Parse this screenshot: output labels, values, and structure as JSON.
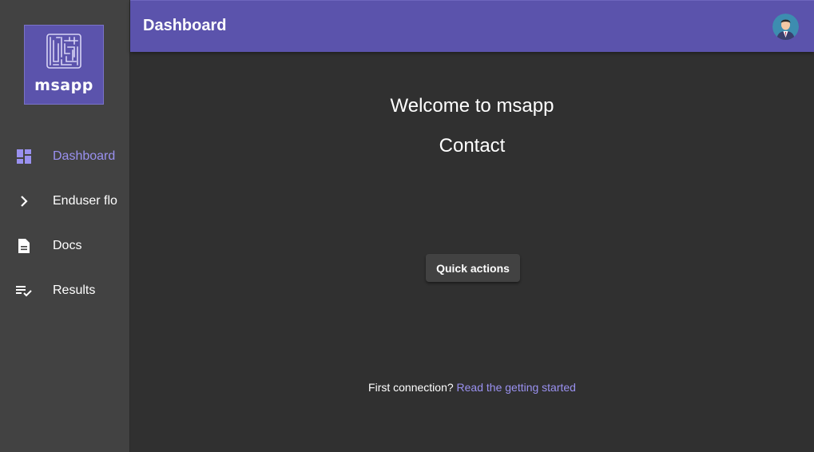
{
  "app": {
    "logo_text": "msapp"
  },
  "colors": {
    "brand": "#5b53ac",
    "accent": "#9a91f0",
    "background": "#303030",
    "sidebar": "#424242"
  },
  "sidebar": {
    "items": [
      {
        "label": "Dashboard",
        "icon": "dashboard-icon",
        "active": true
      },
      {
        "label": "Enduser flo",
        "icon": "chevron-right-icon",
        "active": false
      },
      {
        "label": "Docs",
        "icon": "document-icon",
        "active": false
      },
      {
        "label": "Results",
        "icon": "playlist-check-icon",
        "active": false
      }
    ]
  },
  "header": {
    "title": "Dashboard",
    "avatar_icon": "user-avatar-icon"
  },
  "main": {
    "welcome": "Welcome to msapp",
    "contact": "Contact",
    "quick_actions_label": "Quick actions",
    "first_connection_text": "First connection?",
    "getting_started_link": "Read the getting started"
  }
}
